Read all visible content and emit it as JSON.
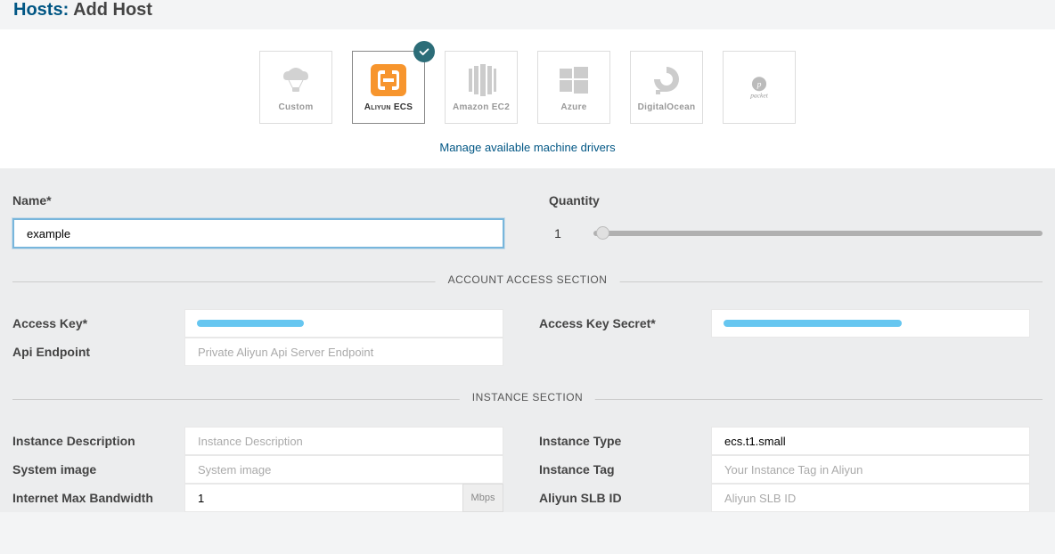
{
  "header": {
    "hosts": "Hosts:",
    "add": "Add Host"
  },
  "providers": [
    {
      "id": "custom",
      "label": "Custom"
    },
    {
      "id": "aliyun",
      "label": "Aliyun ECS",
      "selected": true
    },
    {
      "id": "amazon",
      "label": "Amazon EC2"
    },
    {
      "id": "azure",
      "label": "Azure"
    },
    {
      "id": "digitalocean",
      "label": "DigitalOcean"
    },
    {
      "id": "packet",
      "label": "packet"
    }
  ],
  "manage_link": "Manage available machine drivers",
  "form": {
    "name_label": "Name*",
    "name_value": "example",
    "quantity_label": "Quantity",
    "quantity_value": "1"
  },
  "sections": {
    "account": "ACCOUNT ACCESS SECTION",
    "instance": "INSTANCE SECTION"
  },
  "account": {
    "access_key_label": "Access Key*",
    "access_key_secret_label": "Access Key Secret*",
    "api_endpoint_label": "Api Endpoint",
    "api_endpoint_placeholder": "Private Aliyun Api Server Endpoint"
  },
  "instance": {
    "desc_label": "Instance Description",
    "desc_placeholder": "Instance Description",
    "type_label": "Instance Type",
    "type_value": "ecs.t1.small",
    "image_label": "System image",
    "image_placeholder": "System image",
    "tag_label": "Instance Tag",
    "tag_placeholder": "Your Instance Tag in Aliyun",
    "bandwidth_label": "Internet Max Bandwidth",
    "bandwidth_value": "1",
    "bandwidth_unit": "Mbps",
    "slb_label": "Aliyun SLB ID",
    "slb_placeholder": "Aliyun SLB ID"
  }
}
